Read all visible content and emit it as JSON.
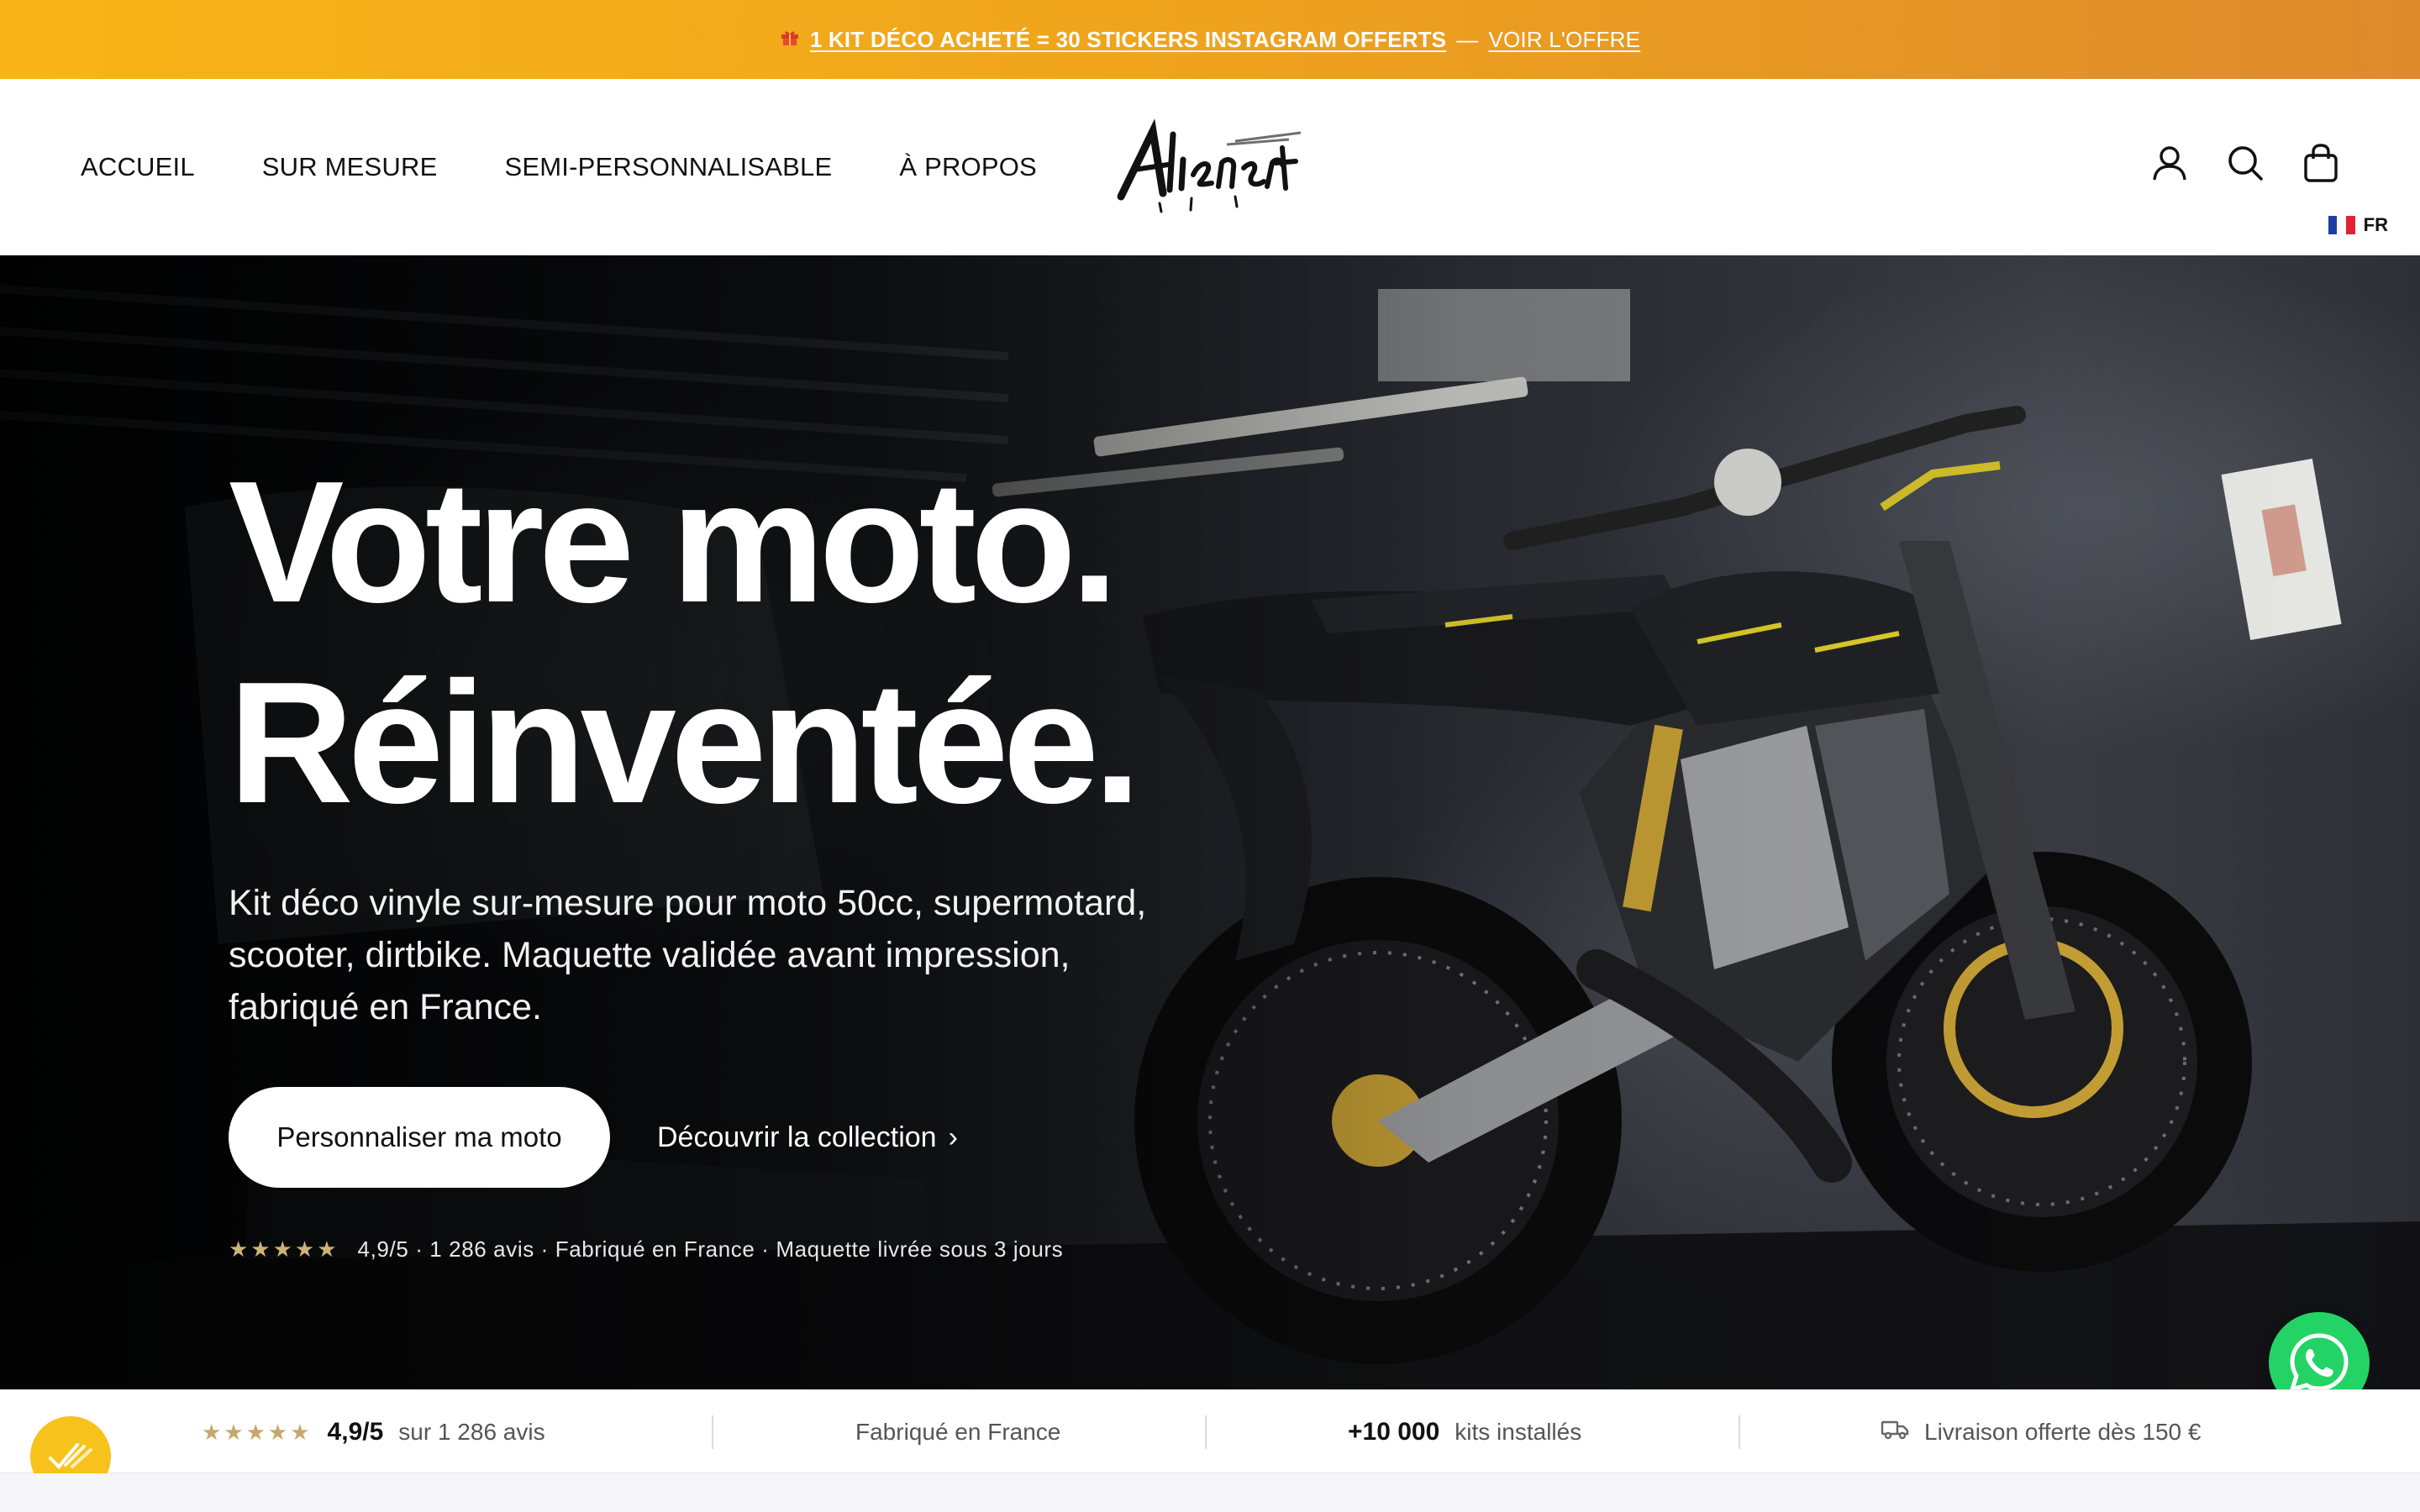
{
  "announcement": {
    "gift_icon": "gift-icon",
    "offer_text": "1 KIT DÉCO ACHETÉ = 30 STICKERS INSTAGRAM OFFERTS",
    "separator": "—",
    "link_text": "VOIR L'OFFRE"
  },
  "nav": {
    "items": [
      {
        "label": "ACCUEIL"
      },
      {
        "label": "SUR MESURE"
      },
      {
        "label": "SEMI-PERSONNALISABLE"
      },
      {
        "label": "À PROPOS"
      }
    ]
  },
  "logo": {
    "text": "Alienarts"
  },
  "header_icons": [
    "account-icon",
    "search-icon",
    "cart-icon"
  ],
  "language": {
    "code": "FR",
    "flag_colors": [
      "#1f3fa0",
      "#ffffff",
      "#e02232"
    ]
  },
  "hero": {
    "headline_line1": "Votre moto.",
    "headline_line2": "Réinventée.",
    "subline": "Kit déco vinyle sur-mesure pour moto 50cc, supermotard, scooter, dirtbike. Maquette validée avant impression, fabriqué en France.",
    "cta_primary": "Personnaliser ma moto",
    "cta_secondary": "Découvrir la collection",
    "cta_secondary_arrow": "›",
    "proof_stars": "★★★★★",
    "proof_text": "4,9/5 · 1 286 avis · Fabriqué en France · Maquette livrée sous 3 jours"
  },
  "trust_bar": {
    "rating_stars": "★★★★★",
    "rating_value": "4,9/5",
    "rating_text": "sur 1 286 avis",
    "made_in": "Fabriqué en France",
    "kits_value": "+10 000",
    "kits_text": "kits installés",
    "shipping_text": "Livraison offerte dès 150 €"
  },
  "colors": {
    "announcement_start": "#f8b418",
    "announcement_end": "#df8a2c",
    "whatsapp": "#24d366",
    "badge": "#f7c21b",
    "star_gold": "#c8a769"
  }
}
